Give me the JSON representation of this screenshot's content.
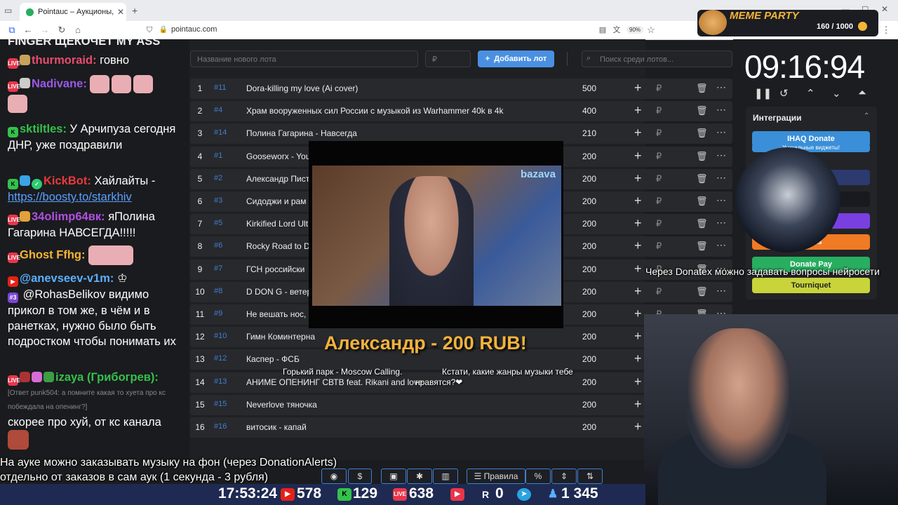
{
  "browser": {
    "tab_title": "Pointauc – Аукционы, лотереи",
    "url": "pointauc.com",
    "zoom": "90%"
  },
  "chat": {
    "top_text": "FINGER ЩЕКОЧЕТ MY ASS",
    "messages": [
      {
        "user": "thurmoraid:",
        "text": "говно",
        "color": "#e84c6d"
      },
      {
        "user": "Nadivane:",
        "text": "",
        "color": "#9b59e8"
      },
      {
        "user": "sktiltles:",
        "text": "У Арчипуза сегодня ДНР, уже поздравили",
        "color": "#33c24b"
      },
      {
        "user": "KickBot:",
        "text": "Хайлайты -",
        "link": "https://boosty.to/starkhiv",
        "color": "#e83a3a"
      },
      {
        "user": "34olimp64вк:",
        "text": "яПолина Гагарина НАВСЕГДА!!!!!",
        "color": "#b04fe0"
      },
      {
        "user": "Ghost Ffhg:",
        "text": "",
        "color": "#f5b536"
      },
      {
        "user": "@anevseev-v1m:",
        "text": "@RohasBelikov видимо прикол в том же, в чём и в ранетках, нужно было быть подростком чтобы понимать их",
        "color": "#5ab0ff",
        "badge": "#3"
      },
      {
        "user": "izaya (Грибогрев):",
        "reply": "[Ответ punk504: а помните какая то хуета про кс побеждала на опенинг?]",
        "text": "скорее про хуй, от кс канала",
        "color": "#33c24b"
      }
    ]
  },
  "auction": {
    "new_lot_placeholder": "Название нового лота",
    "amount_placeholder": "₽",
    "add_button": "Добавить лот",
    "search_placeholder": "Поиск среди лотов...",
    "rows": [
      {
        "n": "1",
        "id": "#11",
        "name": "Dora-killing my love (Ai cover)",
        "amount": "500"
      },
      {
        "n": "2",
        "id": "#4",
        "name": "Храм вооруженных сил России с музыкой из Warhammer 40k в 4k",
        "amount": "400"
      },
      {
        "n": "3",
        "id": "#14",
        "name": "Полина Гагарина - Навсегда",
        "amount": "210"
      },
      {
        "n": "4",
        "id": "#1",
        "name": "Gooseworx - You",
        "amount": "200"
      },
      {
        "n": "5",
        "id": "#2",
        "name": "Александр Пист",
        "amount": "200"
      },
      {
        "n": "6",
        "id": "#3",
        "name": "Сидоджи и рам",
        "amount": "200"
      },
      {
        "n": "7",
        "id": "#5",
        "name": "Kirkified Lord Ult",
        "amount": "200"
      },
      {
        "n": "8",
        "id": "#6",
        "name": "Rocky Road to D",
        "amount": "200"
      },
      {
        "n": "9",
        "id": "#7",
        "name": "ГСН российски",
        "amount": "200"
      },
      {
        "n": "10",
        "id": "#8",
        "name": "D DON G - ветер",
        "amount": "200"
      },
      {
        "n": "11",
        "id": "#9",
        "name": "Не вешать нос,",
        "amount": "200"
      },
      {
        "n": "12",
        "id": "#10",
        "name": "Гимн Коминтерна",
        "amount": "200"
      },
      {
        "n": "13",
        "id": "#12",
        "name": "Каспер - ФСБ",
        "amount": "200"
      },
      {
        "n": "14",
        "id": "#13",
        "name": "АНИМЕ ОПЕНИНГ СВТВ feat. Rikani and love",
        "amount": "200"
      },
      {
        "n": "15",
        "id": "#15",
        "name": "Neverlove тяночка",
        "amount": "200"
      },
      {
        "n": "16",
        "id": "#16",
        "name": "витосик - капай",
        "amount": "200"
      }
    ]
  },
  "video": {
    "logo": "bazava"
  },
  "overlay": {
    "donation": "Александр - 200 RUB!",
    "song_left": "Горький парк - Moscow Calling.",
    "song_right_1": "Кстати, какие жанры музыки тебе",
    "song_right_2": "нравятся?❤",
    "side_note": "Через Donatex можно задавать вопросы нейросети",
    "bottom_1": "На ауке можно заказывать музыку на фон (через DonationAlerts)",
    "bottom_2": "отдельно от заказов в сам аук (1 секунда - 3 рубля)"
  },
  "timer": {
    "value": "09:16:94"
  },
  "integrations": {
    "title": "Интеграции",
    "buttons": [
      {
        "label": "IHAQ Donate",
        "color": "#3a8fd8"
      },
      {
        "label": "Уникальные виджеты!",
        "color": "#3a8fd8"
      },
      {
        "label": "er",
        "color": "#2c3a70"
      },
      {
        "label": "",
        "color": "#191a1f"
      },
      {
        "label": "",
        "color": "#7a3fe0"
      },
      {
        "label": "Alerts",
        "color": "#f17a25"
      },
      {
        "label": "Donate Pay",
        "color": "#27ae60"
      },
      {
        "label": "Tourniquet",
        "color": "#c8d43a"
      }
    ]
  },
  "meme_party": {
    "title": "MEME PARTY",
    "count": "160 / 1000"
  },
  "toolbar": {
    "rules": "Правила",
    "percent": "%"
  },
  "stats": {
    "time": "17:53:24",
    "youtube": "578",
    "kick": "129",
    "live": "638",
    "rutube": "0",
    "viewers": "1 345"
  }
}
